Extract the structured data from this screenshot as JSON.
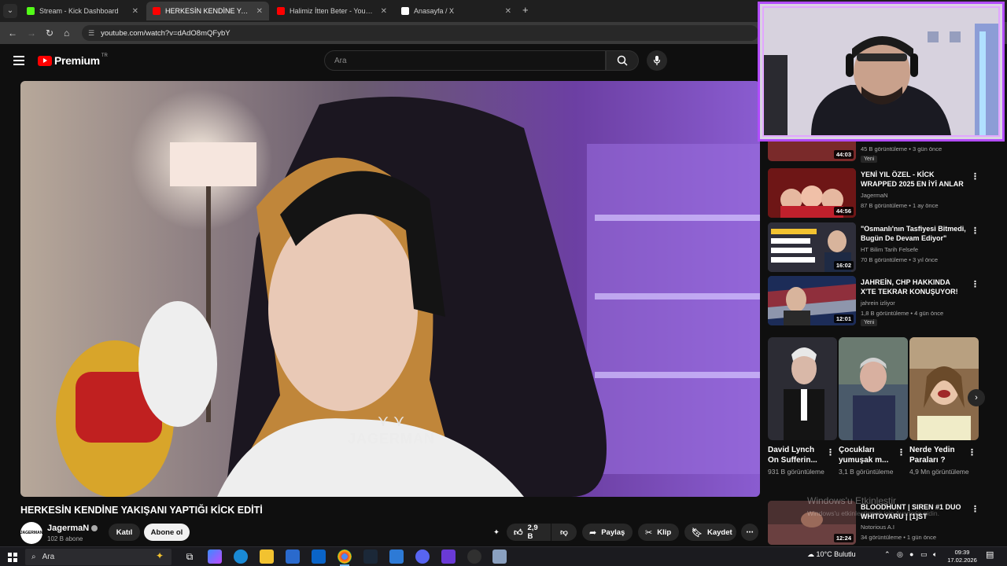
{
  "browser": {
    "tabs": [
      {
        "title": "Stream - Kick Dashboard",
        "favicon_color": "#53fc18"
      },
      {
        "title": "HERKESİN KENDİNE YAKIŞANI",
        "favicon_color": "#ff0000"
      },
      {
        "title": "Halimiz İtten Beter - YouTube",
        "favicon_color": "#ff0000"
      },
      {
        "title": "Anasayfa / X",
        "favicon_color": "#ffffff"
      }
    ],
    "url": "youtube.com/watch?v=dAdO8mQFybY"
  },
  "yt_header": {
    "logo_text": "Premium",
    "logo_region": "TR",
    "search_placeholder": "Ara"
  },
  "video": {
    "watermark": "JAGERMAN",
    "title": "HERKESİN KENDİNE YAKIŞANI YAPTIĞI KİCK EDİTİ"
  },
  "channel": {
    "avatar_text": "JAGERMAN",
    "name": "JagermaN",
    "subscribers": "102 B abone",
    "join_label": "Katıl",
    "subscribe_label": "Abone ol"
  },
  "actions": {
    "likes": "2,9 B",
    "share": "Paylaş",
    "clip": "Klip",
    "save": "Kaydet"
  },
  "recommendations": [
    {
      "title": "",
      "channel": "",
      "meta": "45 B görüntüleme • 3 gün önce",
      "duration": "44:03",
      "badge": "Yeni",
      "thumb_color": "#7a2a2a"
    },
    {
      "title": "YENİ YIL ÖZEL - KİCK WRAPPED 2025 EN İYİ ANLAR",
      "channel": "JagermaN",
      "meta": "87 B görüntüleme • 1 ay önce",
      "duration": "44:56",
      "badge": "",
      "thumb_color": "#8e2323"
    },
    {
      "title": "\"Osmanlı'nın Tasfiyesi Bitmedi, Bugün De Devam Ediyor\"",
      "channel": "HT Bilim Tarih Felsefe",
      "meta": "70 B görüntüleme • 3 yıl önce",
      "duration": "16:02",
      "badge": "",
      "thumb_color": "#3a3a48"
    },
    {
      "title": "JAHREİN, CHP HAKKINDA X'TE TEKRAR KONUŞUYOR!",
      "channel": "jahrein izliyor",
      "meta": "1,8 B görüntüleme • 4 gün önce",
      "duration": "12:01",
      "badge": "Yeni",
      "thumb_color": "#2a3a6a"
    },
    {
      "title": "BLOODHUNT | SIREN #1 DUO WHITOYARU | [1]ST",
      "channel": "Notorious A.I",
      "meta": "34 görüntüleme • 1 gün önce",
      "duration": "12:24",
      "badge": "",
      "thumb_color": "#5a3a3a"
    }
  ],
  "shorts": [
    {
      "title": "David Lynch On Sufferin...",
      "views": "931 B görüntüleme",
      "thumb_color": "#2c2c34"
    },
    {
      "title": "Çocukları yumuşak m...",
      "views": "3,1 B görüntüleme",
      "thumb_color": "#4a5a6a"
    },
    {
      "title": "Nerde Yedin Paraları ?",
      "views": "4,9 Mn görüntüleme",
      "thumb_color": "#8a6a4a"
    }
  ],
  "windows_notice": {
    "line1": "Windows'u Etkinleştir",
    "line2": "Windows'u etkinleştirmek için Ayarlar'a gidin."
  },
  "taskbar": {
    "search_placeholder": "Ara",
    "weather": "10°C  Bulutlu",
    "time": "09:39",
    "date": "17.02.2026"
  }
}
